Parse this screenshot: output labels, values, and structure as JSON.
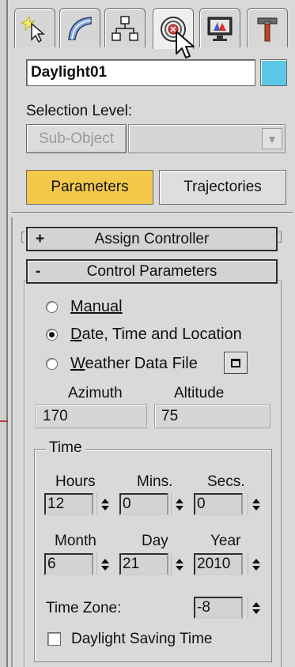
{
  "tabs": [
    {
      "name": "create",
      "icon": "create-icon"
    },
    {
      "name": "modify",
      "icon": "modify-icon"
    },
    {
      "name": "hierarchy",
      "icon": "hierarchy-icon"
    },
    {
      "name": "motion",
      "icon": "motion-icon",
      "active": true
    },
    {
      "name": "display",
      "icon": "display-icon"
    },
    {
      "name": "utilities",
      "icon": "utilities-icon"
    }
  ],
  "object": {
    "name": "Daylight01",
    "color": "#5ac8e6"
  },
  "selection": {
    "label": "Selection Level:",
    "sub_object_label": "Sub-Object",
    "dropdown_value": ""
  },
  "mode_buttons": {
    "parameters": "Parameters",
    "trajectories": "Trajectories",
    "active_color": "#f4c84a"
  },
  "rollouts": {
    "assign_controller": {
      "sign": "+",
      "title": "Assign Controller"
    },
    "control_parameters": {
      "sign": "-",
      "title": "Control Parameters"
    }
  },
  "position_mode": {
    "options": [
      "Manual",
      "Date, Time and Location",
      "Weather Data File"
    ],
    "selected": "Date, Time and Location"
  },
  "angles": {
    "azimuth_label": "Azimuth",
    "azimuth_value": "170",
    "altitude_label": "Altitude",
    "altitude_value": "75"
  },
  "time": {
    "group_label": "Time",
    "hours_label": "Hours",
    "hours": "12",
    "mins_label": "Mins.",
    "mins": "0",
    "secs_label": "Secs.",
    "secs": "0",
    "month_label": "Month",
    "month": "6",
    "day_label": "Day",
    "day": "21",
    "year_label": "Year",
    "year": "2010",
    "timezone_label": "Time Zone:",
    "timezone": "-8",
    "dst_label": "Daylight Saving Time",
    "dst_checked": false
  }
}
